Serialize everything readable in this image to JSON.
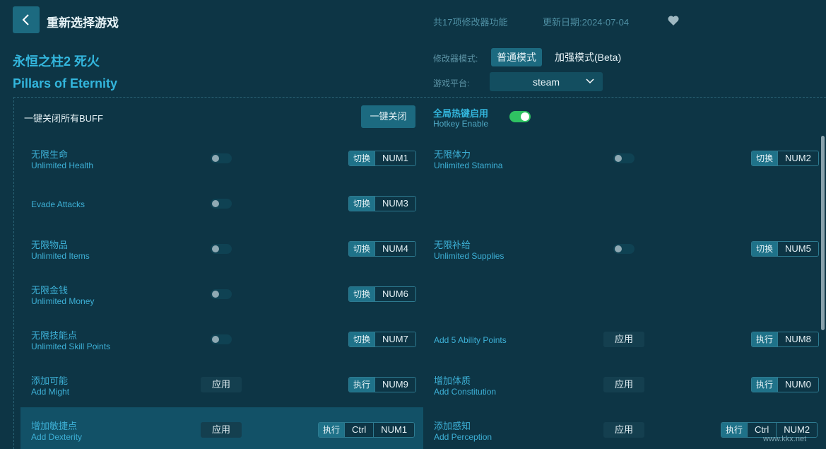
{
  "header": {
    "title": "重新选择游戏",
    "feature_count": "共17项修改器功能",
    "update_date": "更新日期:2024-07-04"
  },
  "game": {
    "name_cn": "永恒之柱2 死火",
    "name_en": "Pillars of Eternity"
  },
  "mode": {
    "label": "修改器模式:",
    "normal": "普通模式",
    "enhanced": "加强模式(Beta)"
  },
  "platform": {
    "label": "游戏平台:",
    "value": "steam"
  },
  "top": {
    "close_all_label": "一键关闭所有BUFF",
    "close_all_button": "一键关闭",
    "hotkey_title": "全局热键启用",
    "hotkey_sub": "Hotkey Enable"
  },
  "items": {
    "i1": {
      "cn": "无限生命",
      "en": "Unlimited Health",
      "act": "切换",
      "key": "NUM1"
    },
    "i2": {
      "cn": "无限体力",
      "en": "Unlimited Stamina",
      "act": "切换",
      "key": "NUM2"
    },
    "i3": {
      "cn": "",
      "en": "Evade Attacks",
      "act": "切换",
      "key": "NUM3"
    },
    "i4": {
      "cn": "无限物品",
      "en": "Unlimited Items",
      "act": "切换",
      "key": "NUM4"
    },
    "i5": {
      "cn": "无限补给",
      "en": "Unlimited Supplies",
      "act": "切换",
      "key": "NUM5"
    },
    "i6": {
      "cn": "无限金钱",
      "en": "Unlimited Money",
      "act": "切换",
      "key": "NUM6"
    },
    "i7": {
      "cn": "无限技能点",
      "en": "Unlimited Skill Points",
      "act": "切换",
      "key": "NUM7"
    },
    "i8": {
      "cn": "",
      "en": "Add 5 Ability Points",
      "apply": "应用",
      "act": "执行",
      "key": "NUM8"
    },
    "i9": {
      "cn": "添加可能",
      "en": "Add Might",
      "apply": "应用",
      "act": "执行",
      "key": "NUM9"
    },
    "i10": {
      "cn": "增加体质",
      "en": "Add Constitution",
      "apply": "应用",
      "act": "执行",
      "key": "NUM0"
    },
    "i11": {
      "cn": "增加敏捷点",
      "en": "Add Dexterity",
      "apply": "应用",
      "act": "执行",
      "mod": "Ctrl",
      "key": "NUM1"
    },
    "i12": {
      "cn": "添加感知",
      "en": "Add Perception",
      "apply": "应用",
      "act": "执行",
      "mod": "Ctrl",
      "key": "NUM2"
    }
  },
  "watermark": "www.kkx.net"
}
